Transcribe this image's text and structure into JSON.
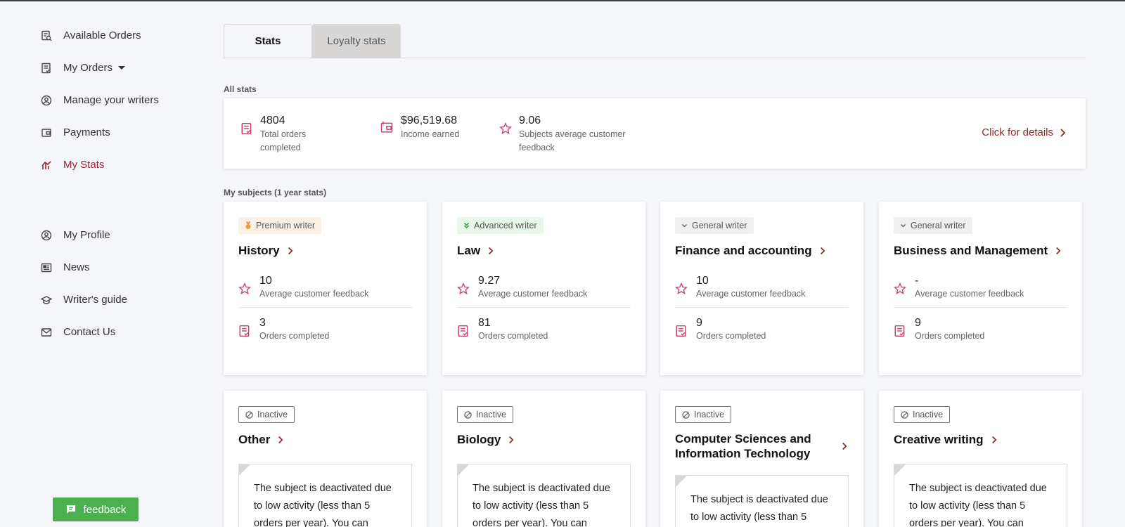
{
  "sidebar": {
    "items": [
      {
        "label": "Available Orders",
        "icon": "order-search-icon"
      },
      {
        "label": "My Orders",
        "icon": "orders-list-icon"
      },
      {
        "label": "Manage your writers",
        "icon": "user-circle-icon"
      },
      {
        "label": "Payments",
        "icon": "wallet-icon"
      },
      {
        "label": "My Stats",
        "icon": "stats-icon",
        "active": true
      },
      {
        "label": "My Profile",
        "icon": "profile-icon"
      },
      {
        "label": "News",
        "icon": "news-icon"
      },
      {
        "label": "Writer's guide",
        "icon": "graduation-cap-icon"
      },
      {
        "label": "Contact Us",
        "icon": "mail-icon"
      }
    ],
    "feedback_label": "feedback"
  },
  "tabs": [
    {
      "label": "Stats",
      "active": true
    },
    {
      "label": "Loyalty stats",
      "active": false
    }
  ],
  "all_stats": {
    "label": "All stats",
    "total_orders": {
      "value": "4804",
      "label": "Total orders completed"
    },
    "income": {
      "value": "$96,519.68",
      "label": "Income earned"
    },
    "feedback": {
      "value": "9.06",
      "label": "Subjects average customer feedback"
    },
    "details_link": "Click for details"
  },
  "subjects": {
    "label": "My subjects (1 year stats)",
    "metric_labels": {
      "feedback": "Average customer feedback",
      "orders": "Orders completed"
    },
    "active": [
      {
        "badge": "Premium writer",
        "title": "History",
        "feedback": "10",
        "orders": "3"
      },
      {
        "badge": "Advanced writer",
        "title": "Law",
        "feedback": "9.27",
        "orders": "81"
      },
      {
        "badge": "General writer",
        "title": "Finance and accounting",
        "feedback": "10",
        "orders": "9"
      },
      {
        "badge": "General writer",
        "title": "Business and Management",
        "feedback": "-",
        "orders": "9"
      }
    ],
    "inactive_badge": "Inactive",
    "inactive": [
      {
        "title": "Other",
        "notice": "The subject is deactivated due to low activity (less than 5 orders per year). You can"
      },
      {
        "title": "Biology",
        "notice": "The subject is deactivated due to low activity (less than 5 orders per year). You can"
      },
      {
        "title": "Computer Sciences and Information Technology",
        "notice": "The subject is deactivated due to low activity (less than 5"
      },
      {
        "title": "Creative writing",
        "notice": "The subject is deactivated due to low activity (less than 5 orders per year). You can"
      }
    ]
  },
  "colors": {
    "accent": "#9b2335",
    "feedback_button": "#4caf50",
    "icon_pink": "#c9406a"
  }
}
